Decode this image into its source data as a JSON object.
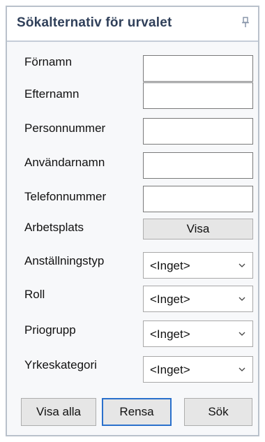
{
  "panel": {
    "title": "Sökalternativ för urvalet",
    "pin_icon": "pin-icon"
  },
  "fields": [
    {
      "label": "Förnamn",
      "value": ""
    },
    {
      "label": "Efternamn",
      "value": ""
    },
    {
      "label": "Personnummer",
      "value": ""
    },
    {
      "label": "Användarnamn",
      "value": ""
    },
    {
      "label": "Telefonnummer",
      "value": ""
    }
  ],
  "arbetsplats": {
    "label": "Arbetsplats",
    "button": "Visa"
  },
  "dropdowns": [
    {
      "label": "Anställningstyp",
      "value": "<Inget>"
    },
    {
      "label": "Roll",
      "value": "<Inget>"
    },
    {
      "label": "Priogrupp",
      "value": "<Inget>"
    },
    {
      "label": "Yrkeskategori",
      "value": "<Inget>"
    }
  ],
  "buttons": {
    "show_all": "Visa alla",
    "clear": "Rensa",
    "search": "Sök"
  },
  "colors": {
    "accent": "#2a70cc",
    "title_text": "#30405a"
  }
}
